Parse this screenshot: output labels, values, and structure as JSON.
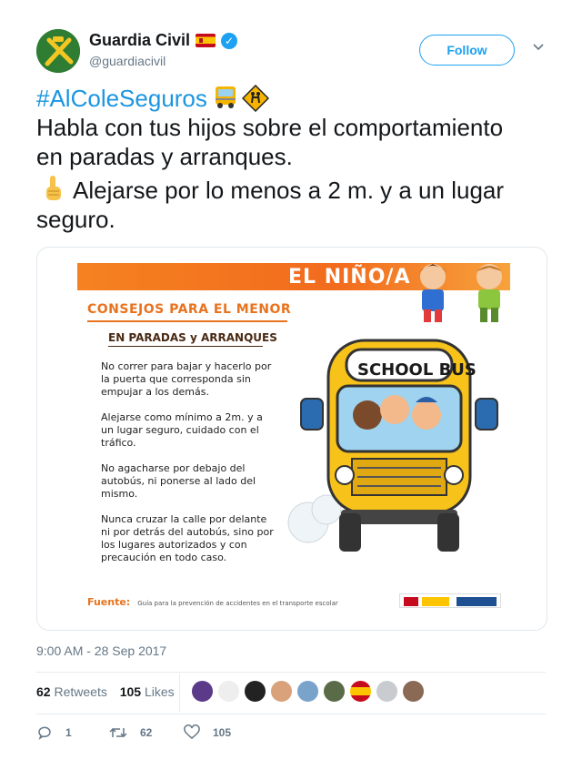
{
  "account": {
    "display_name": "Guardia Civil",
    "handle": "@guardiacivil",
    "follow_label": "Follow"
  },
  "tweet": {
    "hashtag": "#AlColeSeguros",
    "line1": "Habla con tus hijos sobre el comportamiento",
    "line2": "en paradas y arranques.",
    "line3": "Alejarse por lo menos a 2 m. y a un lugar",
    "line4": "seguro."
  },
  "media": {
    "banner": "EL NIÑO/A",
    "heading": "CONSEJOS PARA EL MENOR",
    "subheading": "EN PARADAS y ARRANQUES",
    "bus_sign": "SCHOOL BUS",
    "advice": [
      "No correr para bajar y hacerlo por la puerta que corresponda sin empujar a los demás.",
      "Alejarse como mínimo a 2m. y a un lugar seguro, cuidado con el tráfico.",
      "No agacharse por debajo del autobús, ni ponerse al lado del mismo.",
      "Nunca cruzar la calle por delante ni por detrás del autobús, sino por los lugares autorizados y con precaución en todo caso."
    ],
    "source_label": "Fuente:",
    "source_text": "Guía para la prevención de accidentes en el transporte escolar"
  },
  "timestamp": "9:00 AM - 28 Sep 2017",
  "stats": {
    "retweets_count": "62",
    "retweets_label": "Retweets",
    "likes_count": "105",
    "likes_label": "Likes"
  },
  "actions": {
    "reply_count": "1",
    "retweet_count": "62",
    "like_count": "105"
  },
  "colors": {
    "link": "#1b95e0",
    "follow": "#1da1f2",
    "secondary_text": "#657786",
    "banner_orange": "#f58220"
  },
  "icons": [
    "guardia-civil-logo-icon",
    "spain-flag-icon",
    "verified-badge-icon",
    "chevron-down-icon",
    "bus-emoji-icon",
    "children-crossing-emoji-icon",
    "pointing-finger-emoji-icon",
    "reply-icon",
    "retweet-icon",
    "heart-icon"
  ]
}
